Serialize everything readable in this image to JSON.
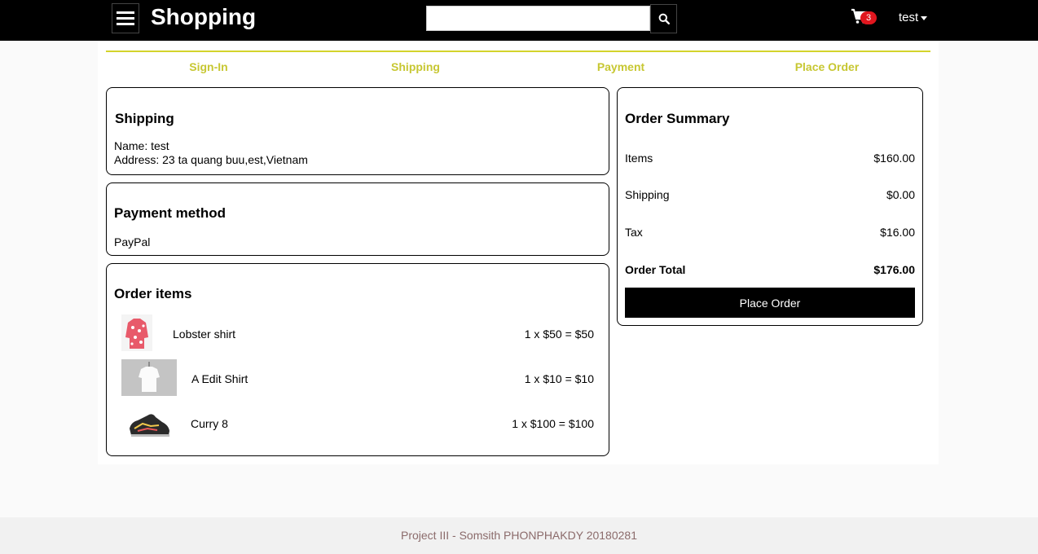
{
  "header": {
    "brand": "Shopping",
    "search_value": "",
    "cart_count": "3",
    "user_name": "test"
  },
  "steps": [
    "Sign-In",
    "Shipping",
    "Payment",
    "Place Order"
  ],
  "shipping": {
    "title": "Shipping",
    "name_line": "Name: test",
    "address_line": "Address: 23 ta quang buu,est,Vietnam"
  },
  "payment": {
    "title": "Payment method",
    "method": "PayPal"
  },
  "order_items": {
    "title": "Order items",
    "items": [
      {
        "name": "Lobster shirt",
        "price_line": "1 x $50 = $50"
      },
      {
        "name": "A Edit Shirt",
        "price_line": "1 x $10 = $10"
      },
      {
        "name": "Curry 8",
        "price_line": "1 x $100 = $100"
      }
    ]
  },
  "summary": {
    "title": "Order Summary",
    "items_label": "Items",
    "items_value": "$160.00",
    "shipping_label": "Shipping",
    "shipping_value": "$0.00",
    "tax_label": "Tax",
    "tax_value": "$16.00",
    "total_label": "Order Total",
    "total_value": "$176.00",
    "place_order_label": "Place Order"
  },
  "footer": {
    "text": "Project III - Somsith PHONPHAKDY 20180281"
  },
  "colors": {
    "accent": "#c7c732",
    "header_bg": "#000000",
    "badge": "#e0161e"
  }
}
